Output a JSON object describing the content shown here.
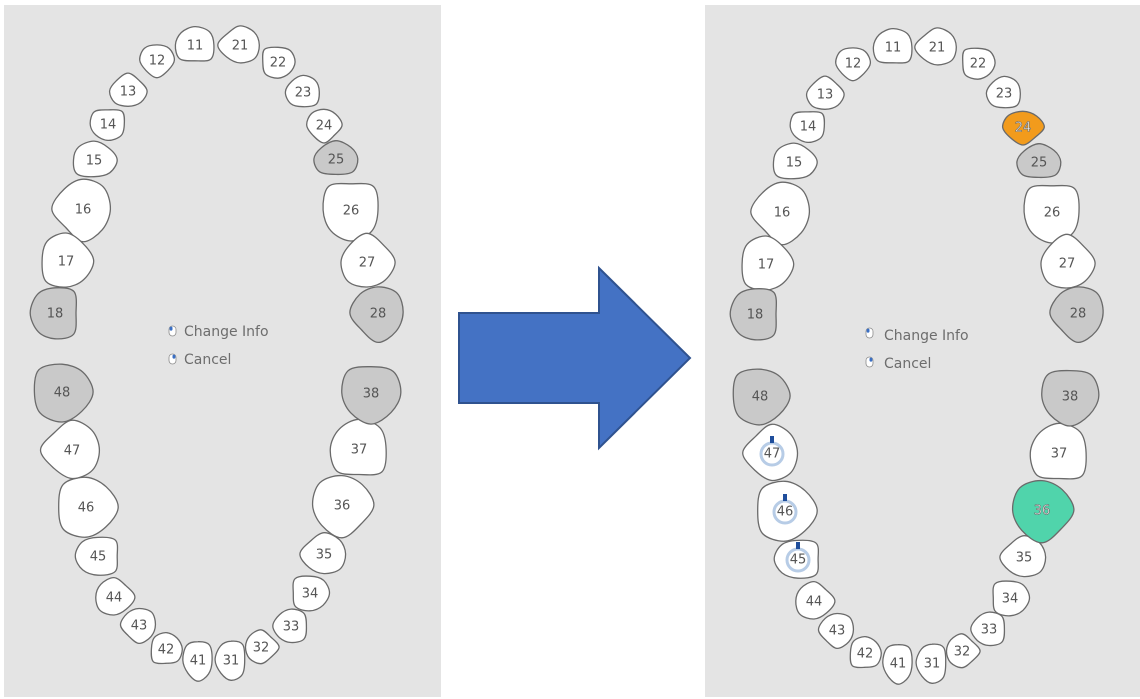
{
  "colors": {
    "panel_bg": "#e4e4e4",
    "tooth_fill": "#ffffff",
    "tooth_outline": "#6a6a6a",
    "missing_fill": "#c9c9c9",
    "selected_orange": "#f29b1c",
    "selected_green": "#50d4ab",
    "marker_blue": "#1f4e9c",
    "marker_halo": "#b7cce6",
    "arrow_fill": "#4472c4",
    "arrow_stroke": "#2f528f"
  },
  "legend": {
    "change_info": "Change Info",
    "cancel": "Cancel",
    "change_info_icon": "mouse-left-click-icon",
    "cancel_icon": "mouse-right-click-icon"
  },
  "arrow_icon": "right-arrow-icon",
  "charts": {
    "before": {
      "teeth": [
        {
          "label": "11",
          "state": "normal"
        },
        {
          "label": "12",
          "state": "normal"
        },
        {
          "label": "13",
          "state": "normal"
        },
        {
          "label": "14",
          "state": "normal"
        },
        {
          "label": "15",
          "state": "normal"
        },
        {
          "label": "16",
          "state": "normal"
        },
        {
          "label": "17",
          "state": "normal"
        },
        {
          "label": "18",
          "state": "missing"
        },
        {
          "label": "21",
          "state": "normal"
        },
        {
          "label": "22",
          "state": "normal"
        },
        {
          "label": "23",
          "state": "normal"
        },
        {
          "label": "24",
          "state": "normal"
        },
        {
          "label": "25",
          "state": "missing"
        },
        {
          "label": "26",
          "state": "normal"
        },
        {
          "label": "27",
          "state": "normal"
        },
        {
          "label": "28",
          "state": "missing"
        },
        {
          "label": "31",
          "state": "normal"
        },
        {
          "label": "32",
          "state": "normal"
        },
        {
          "label": "33",
          "state": "normal"
        },
        {
          "label": "34",
          "state": "normal"
        },
        {
          "label": "35",
          "state": "normal"
        },
        {
          "label": "36",
          "state": "normal"
        },
        {
          "label": "37",
          "state": "normal"
        },
        {
          "label": "38",
          "state": "missing"
        },
        {
          "label": "41",
          "state": "normal"
        },
        {
          "label": "42",
          "state": "normal"
        },
        {
          "label": "43",
          "state": "normal"
        },
        {
          "label": "44",
          "state": "normal"
        },
        {
          "label": "45",
          "state": "normal"
        },
        {
          "label": "46",
          "state": "normal"
        },
        {
          "label": "47",
          "state": "normal"
        },
        {
          "label": "48",
          "state": "missing"
        }
      ]
    },
    "after": {
      "teeth": [
        {
          "label": "11",
          "state": "normal"
        },
        {
          "label": "12",
          "state": "normal"
        },
        {
          "label": "13",
          "state": "normal"
        },
        {
          "label": "14",
          "state": "normal"
        },
        {
          "label": "15",
          "state": "normal"
        },
        {
          "label": "16",
          "state": "normal"
        },
        {
          "label": "17",
          "state": "normal"
        },
        {
          "label": "18",
          "state": "missing"
        },
        {
          "label": "21",
          "state": "normal"
        },
        {
          "label": "22",
          "state": "normal"
        },
        {
          "label": "23",
          "state": "normal"
        },
        {
          "label": "24",
          "state": "selected-orange"
        },
        {
          "label": "25",
          "state": "missing"
        },
        {
          "label": "26",
          "state": "normal"
        },
        {
          "label": "27",
          "state": "normal"
        },
        {
          "label": "28",
          "state": "missing"
        },
        {
          "label": "31",
          "state": "normal"
        },
        {
          "label": "32",
          "state": "normal"
        },
        {
          "label": "33",
          "state": "normal"
        },
        {
          "label": "34",
          "state": "normal"
        },
        {
          "label": "35",
          "state": "normal"
        },
        {
          "label": "36",
          "state": "selected-green"
        },
        {
          "label": "37",
          "state": "normal"
        },
        {
          "label": "38",
          "state": "missing"
        },
        {
          "label": "41",
          "state": "normal"
        },
        {
          "label": "42",
          "state": "normal"
        },
        {
          "label": "43",
          "state": "normal"
        },
        {
          "label": "44",
          "state": "normal"
        },
        {
          "label": "45",
          "state": "marked"
        },
        {
          "label": "46",
          "state": "marked"
        },
        {
          "label": "47",
          "state": "marked"
        },
        {
          "label": "48",
          "state": "missing"
        }
      ]
    }
  }
}
